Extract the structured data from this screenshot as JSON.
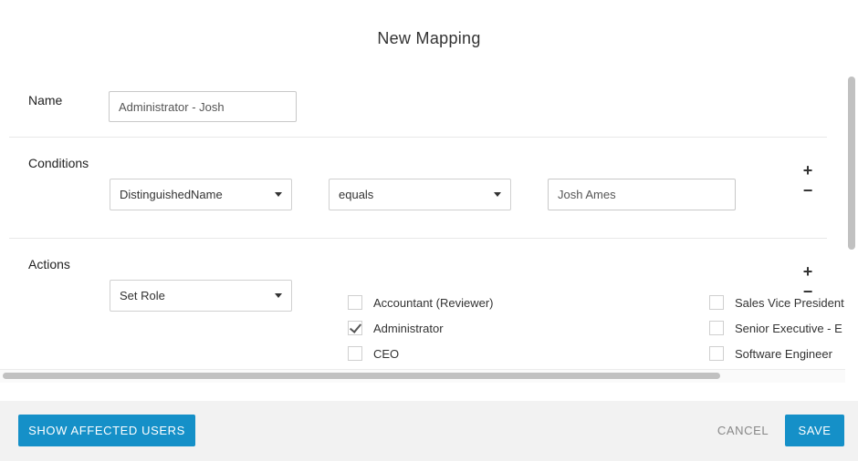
{
  "dialog": {
    "title": "New Mapping"
  },
  "name_section": {
    "label": "Name",
    "value": "Administrator - Josh"
  },
  "conditions": {
    "label": "Conditions",
    "attribute": "DistinguishedName",
    "operator": "equals",
    "value": "Josh Ames",
    "add_symbol": "+",
    "remove_symbol": "−"
  },
  "actions": {
    "label": "Actions",
    "action": "Set Role",
    "add_symbol": "+",
    "remove_symbol": "−",
    "roles_left": [
      {
        "label": "Accountant (Reviewer)",
        "checked": false
      },
      {
        "label": "Administrator",
        "checked": true
      },
      {
        "label": "CEO",
        "checked": false
      }
    ],
    "roles_right": [
      {
        "label": "Sales Vice President",
        "checked": false
      },
      {
        "label": "Senior Executive - E",
        "checked": false
      },
      {
        "label": "Software Engineer",
        "checked": false
      }
    ]
  },
  "footer": {
    "show_affected_label": "SHOW AFFECTED USERS",
    "cancel_label": "CANCEL",
    "save_label": "SAVE"
  },
  "colors": {
    "primary": "#1590c8",
    "footer_bg": "#f2f2f2"
  }
}
